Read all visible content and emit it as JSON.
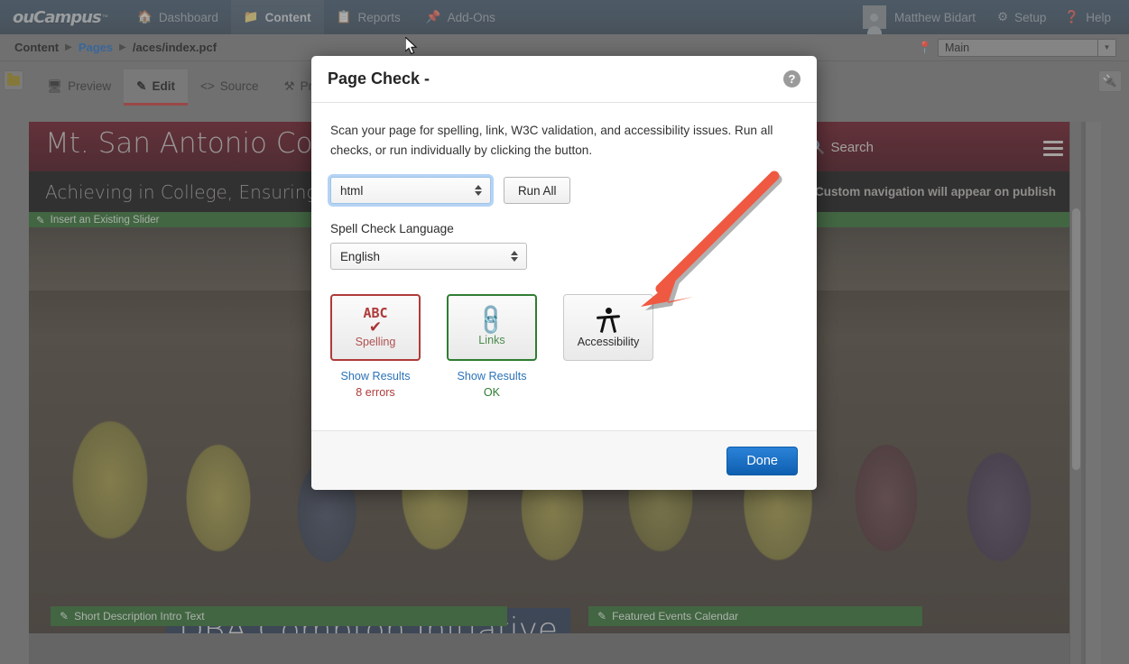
{
  "topnav": {
    "logo": "ouCampus",
    "logo_tm": "™",
    "items": [
      {
        "label": "Dashboard",
        "icon": "home-icon"
      },
      {
        "label": "Content",
        "icon": "folder-icon"
      },
      {
        "label": "Reports",
        "icon": "clipboard-icon"
      },
      {
        "label": "Add-Ons",
        "icon": "pin-icon"
      }
    ],
    "user": "Matthew Bidart",
    "setup": "Setup",
    "help": "Help"
  },
  "breadcrumb": {
    "root": "Content",
    "section": "Pages",
    "current": "/aces/index.pcf",
    "site_value": "Main"
  },
  "toolbar": {
    "tabs": [
      {
        "label": "Preview",
        "icon": "monitor-icon"
      },
      {
        "label": "Edit",
        "icon": "pencil-icon"
      },
      {
        "label": "Source",
        "icon": "code-icon"
      },
      {
        "label": "Properties",
        "icon": "tools-icon"
      }
    ]
  },
  "preview": {
    "banner_title": "Mt. San Antonio College",
    "search_label": "Search",
    "tagline": "Achieving in College, Ensuring Success",
    "nav_note": "Custom navigation will appear on publish",
    "slider_region": "Insert an Existing Slider",
    "photo_caption": "DBA Compton Initiative",
    "bottom_left_region": "Short Description Intro Text",
    "bottom_right_region": "Featured Events Calendar"
  },
  "modal": {
    "title": "Page Check -",
    "help_glyph": "?",
    "description": "Scan your page for spelling, link, W3C validation, and accessibility issues. Run all checks, or run individually by clicking the button.",
    "type_select_value": "html",
    "run_all_label": "Run All",
    "lang_label": "Spell Check Language",
    "lang_select_value": "English",
    "checks": [
      {
        "name": "Spelling",
        "icon": "abc-checkmark-icon",
        "state": "error",
        "results_link": "Show Results",
        "status": "8 errors"
      },
      {
        "name": "Links",
        "icon": "chain-link-icon",
        "state": "ok",
        "results_link": "Show Results",
        "status": "OK"
      },
      {
        "name": "Accessibility",
        "icon": "accessibility-person-icon",
        "state": "neutral",
        "results_link": "",
        "status": ""
      }
    ],
    "done_label": "Done"
  },
  "colors": {
    "nav_bg": "#16314a",
    "accent_blue": "#2a72b8",
    "error_red": "#b03a3a",
    "ok_green": "#2f7d32",
    "annotation_red": "#ef5942",
    "banner_maroon": "#5c1420"
  }
}
